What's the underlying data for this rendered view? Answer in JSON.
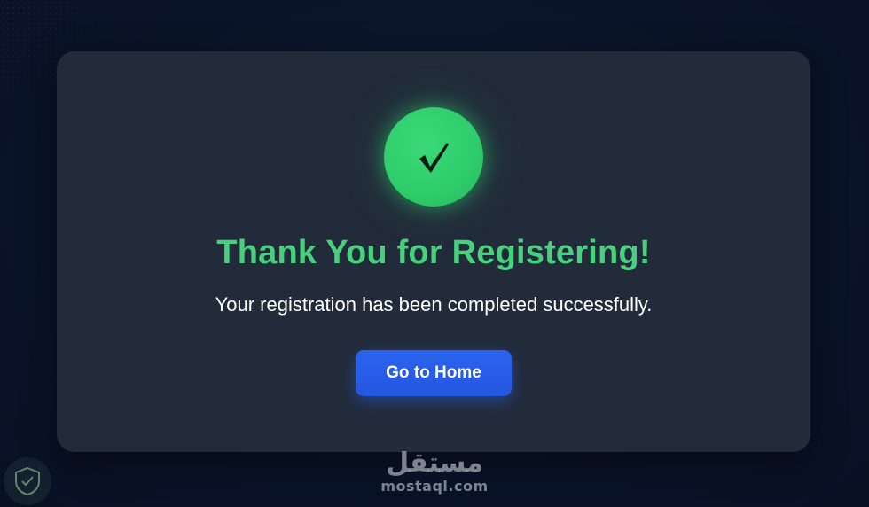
{
  "colors": {
    "page_background": "#0a1428",
    "card_background": "#222b3a",
    "success_green": "#48d17c",
    "check_circle": "#2ecc6a",
    "button_blue": "#2557e0",
    "text_white": "#ffffff"
  },
  "confirmation": {
    "icon": "checkmark-icon",
    "title": "Thank You for Registering!",
    "message": "Your registration has been completed successfully.",
    "button_label": "Go to Home"
  },
  "watermark": {
    "arabic_text": "مستقل",
    "site": "mostaql.com",
    "shield_icon": "shield-check-icon"
  }
}
